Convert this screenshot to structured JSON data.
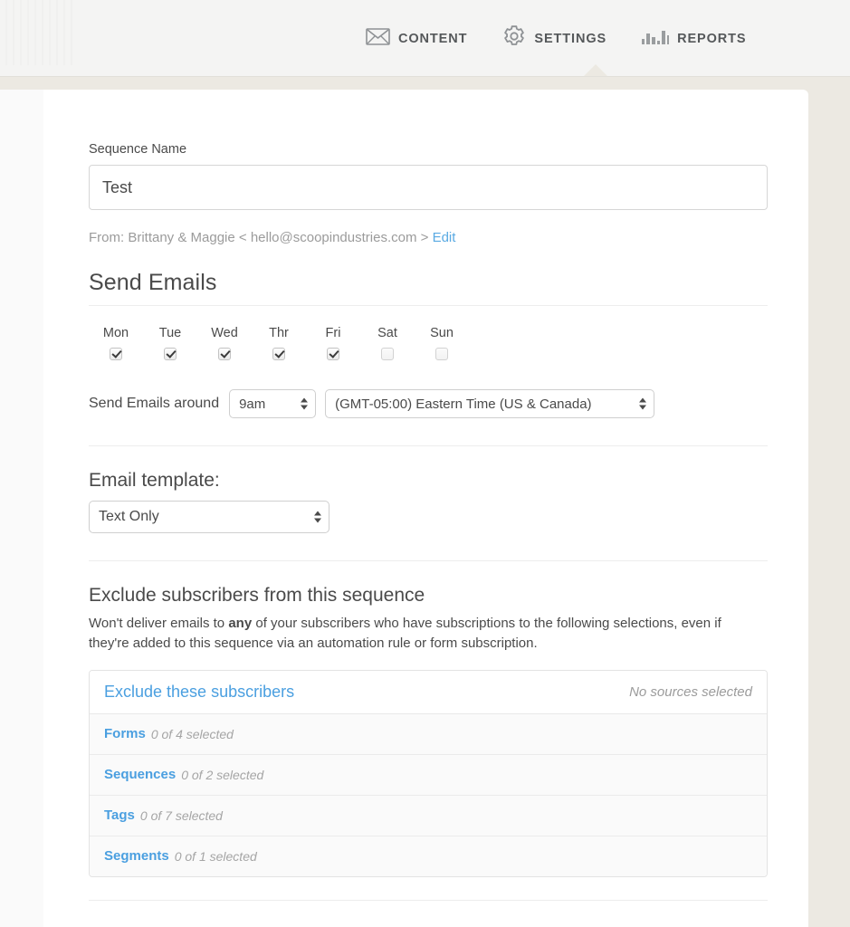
{
  "header": {
    "nav": [
      {
        "label": "CONTENT",
        "icon": "envelope-icon",
        "active": false
      },
      {
        "label": "SETTINGS",
        "icon": "gear-icon",
        "active": true
      },
      {
        "label": "REPORTS",
        "icon": "bar-chart-icon",
        "active": false
      }
    ]
  },
  "form": {
    "sequence_name_label": "Sequence Name",
    "sequence_name_value": "Test",
    "sequence_name_placeholder": "Sequence Name",
    "from_prefix": "From: Brittany & Maggie < hello@scoopindustries.com >",
    "from_edit_label": "Edit"
  },
  "send_emails": {
    "title": "Send Emails",
    "days": [
      {
        "name": "Mon",
        "checked": true
      },
      {
        "name": "Tue",
        "checked": true
      },
      {
        "name": "Wed",
        "checked": true
      },
      {
        "name": "Thr",
        "checked": true
      },
      {
        "name": "Fri",
        "checked": true
      },
      {
        "name": "Sat",
        "checked": false
      },
      {
        "name": "Sun",
        "checked": false
      }
    ],
    "around_label": "Send Emails around",
    "time_value": "9am",
    "timezone_value": "(GMT-05:00) Eastern Time (US & Canada)"
  },
  "email_template": {
    "label": "Email template:",
    "value": "Text Only"
  },
  "exclude": {
    "title": "Exclude subscribers from this sequence",
    "description_part1": "Won't deliver emails to ",
    "description_bold": "any",
    "description_part2": " of your subscribers who have subscriptions to the following selections, even if they're added to this sequence via an automation rule or form subscription.",
    "panel_title": "Exclude these subscribers",
    "panel_status": "No sources selected",
    "rows": [
      {
        "name": "Forms",
        "count": "0 of 4 selected"
      },
      {
        "name": "Sequences",
        "count": "0 of 2 selected"
      },
      {
        "name": "Tags",
        "count": "0 of 7 selected"
      },
      {
        "name": "Segments",
        "count": "0 of 1 selected"
      }
    ]
  },
  "colors": {
    "link_blue": "#4a9fe0",
    "page_bg": "#ece9e2",
    "text": "#4a4a4a"
  }
}
